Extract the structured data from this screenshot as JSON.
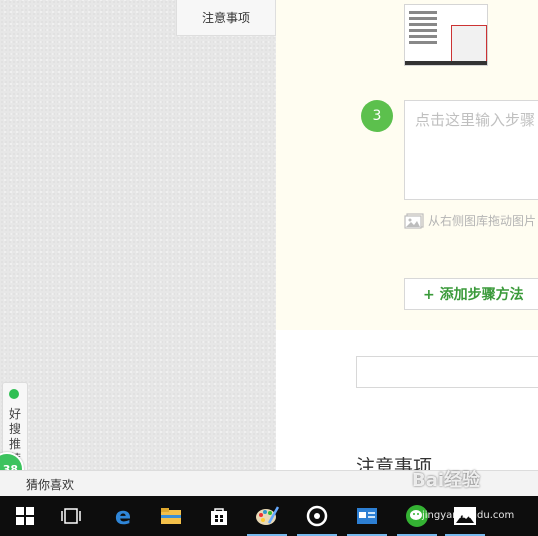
{
  "sidebar": {
    "notes_tab_label": "注意事项"
  },
  "side_widget": {
    "text": "好搜推荐",
    "badge_count": "38"
  },
  "editor": {
    "step_number": "3",
    "step_placeholder": "点击这里输入步骤",
    "drag_hint": "从右侧图库拖动图片",
    "add_step_label": "+ 添加步骤方法",
    "section_title": "注意事项"
  },
  "guess_bar": {
    "label": "猜你喜欢"
  },
  "watermark": {
    "brand": "Bai经验",
    "url": "jingyan.baidu.com"
  },
  "taskbar": {
    "items": [
      "start",
      "task-view",
      "edge",
      "file-explorer",
      "store",
      "paint",
      "media-player",
      "app",
      "wechat",
      "photos"
    ]
  },
  "colors": {
    "step_green": "#5cc04d",
    "add_step_green": "#3a9a3a",
    "editor_bg": "#fffdf1",
    "taskbar_bg": "#0d0d0d"
  }
}
